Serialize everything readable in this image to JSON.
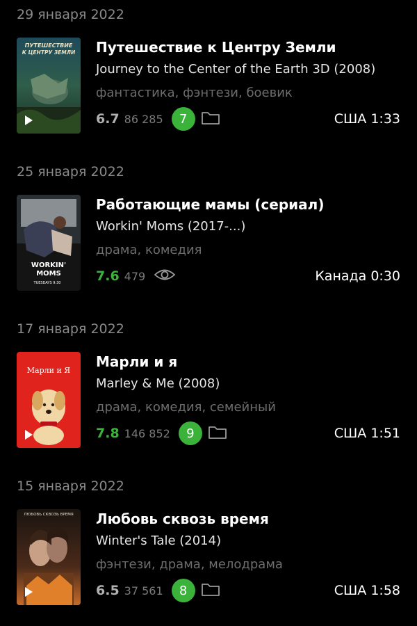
{
  "entries": [
    {
      "date": "29 января 2022",
      "title": "Путешествие к Центру Земли",
      "original": "Journey to the Center of the Earth 3D (2008)",
      "genres": "фантастика, фэнтези, боевик",
      "score": "6.7",
      "votes": "86 285",
      "my_rating": "7",
      "country_duration": "США 1:33",
      "poster_text": [
        "ПУТЕШЕСТВИЕ",
        "К ЦЕНТРУ ЗЕМЛИ"
      ]
    },
    {
      "date": "25 января 2022",
      "title": "Работающие мамы (сериал)",
      "original": "Workin' Moms (2017-...)",
      "genres": "драма, комедия",
      "score": "7.6",
      "votes": "479",
      "country_duration": "Канада 0:30",
      "poster_text": [
        "WORKIN'",
        "MOMS",
        "TUESDAYS 9:30"
      ]
    },
    {
      "date": "17 января 2022",
      "title": "Марли и я",
      "original": "Marley & Me (2008)",
      "genres": "драма, комедия, семейный",
      "score": "7.8",
      "votes": "146 852",
      "my_rating": "9",
      "country_duration": "США 1:51",
      "poster_text": [
        "Марли и Я"
      ]
    },
    {
      "date": "15 января 2022",
      "title": "Любовь сквозь время",
      "original": "Winter's Tale (2014)",
      "genres": "фэнтези, драма, мелодрама",
      "score": "6.5",
      "votes": "37 561",
      "my_rating": "8",
      "country_duration": "США 1:58",
      "poster_text": [
        "ЛЮБОВЬ СКВОЗЬ ВРЕМЯ"
      ]
    }
  ],
  "colors": {
    "background": "#000000",
    "rating_green": "#3bb33b",
    "secondary_text": "#6d6d6d",
    "date_text": "#8a8a8a"
  }
}
